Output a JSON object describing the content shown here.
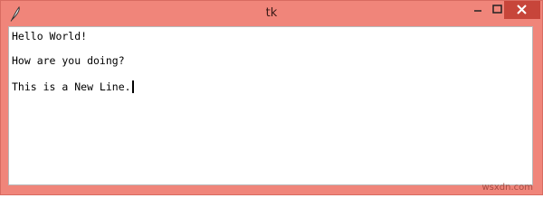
{
  "window": {
    "title": "tk",
    "app_icon": "feather-icon",
    "controls": {
      "minimize_icon": "minimize-icon",
      "maximize_icon": "maximize-icon",
      "close_icon": "close-icon"
    },
    "colors": {
      "frame": "#f0857a",
      "close_button": "#c7453a"
    }
  },
  "text": {
    "line1": "Hello World!",
    "line2": "How are you doing?",
    "line3": "This is a New Line."
  },
  "watermark": "wsxdn.com"
}
